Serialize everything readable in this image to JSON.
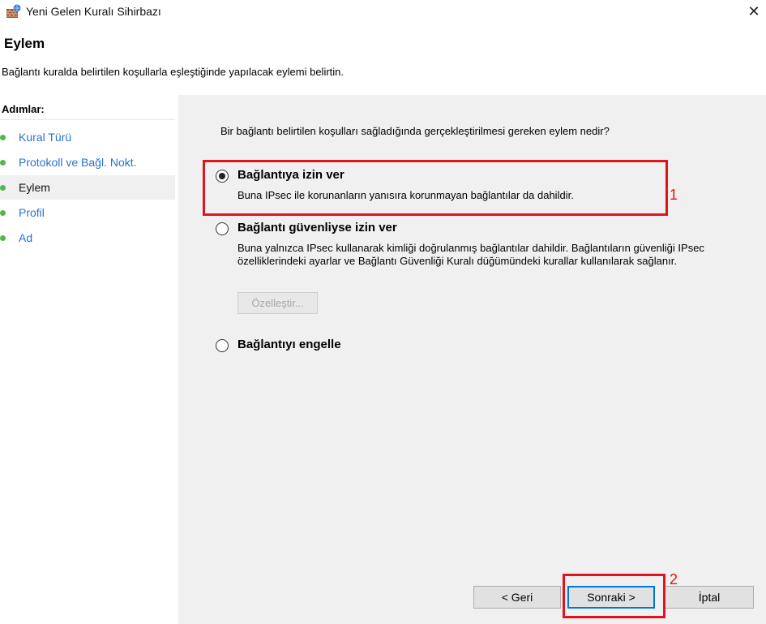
{
  "window": {
    "title": "Yeni Gelen Kuralı Sihirbazı",
    "close_glyph": "✕"
  },
  "header": {
    "title": "Eylem",
    "description": "Bağlantı kuralda belirtilen koşullarla eşleştiğinde yapılacak eylemi belirtin."
  },
  "steps": {
    "title": "Adımlar:",
    "items": [
      {
        "label": "Kural Türü"
      },
      {
        "label": "Protokoll ve Bağl. Nokt."
      },
      {
        "label": "Eylem"
      },
      {
        "label": "Profil"
      },
      {
        "label": "Ad"
      }
    ]
  },
  "main": {
    "question": "Bir bağlantı belirtilen koşulları sağladığında gerçekleştirilmesi gereken eylem nedir?",
    "options": [
      {
        "label": "Bağlantıya izin ver",
        "description": "Buna IPsec ile korunanların yanısıra korunmayan bağlantılar da dahildir.",
        "selected": true
      },
      {
        "label": "Bağlantı güvenliyse izin ver",
        "description": "Buna yalnızca IPsec kullanarak kimliği doğrulanmış bağlantılar dahildir. Bağlantıların güvenliği IPsec özelliklerindeki ayarlar ve Bağlantı Güvenliği Kuralı düğümündeki kurallar kullanılarak sağlanır.",
        "selected": false
      },
      {
        "label": "Bağlantıyı engelle",
        "description": "",
        "selected": false
      }
    ],
    "customize_label": "Özelleştir..."
  },
  "footer": {
    "back_label": "< Geri",
    "next_label": "Sonraki >",
    "cancel_label": "İptal"
  },
  "annotations": {
    "marker_1": "1",
    "marker_2": "2",
    "color": "#e0141c"
  },
  "colors": {
    "step_link": "#2a73c8",
    "step_bullet": "#50b848",
    "pane_background": "#f0f0f0"
  }
}
